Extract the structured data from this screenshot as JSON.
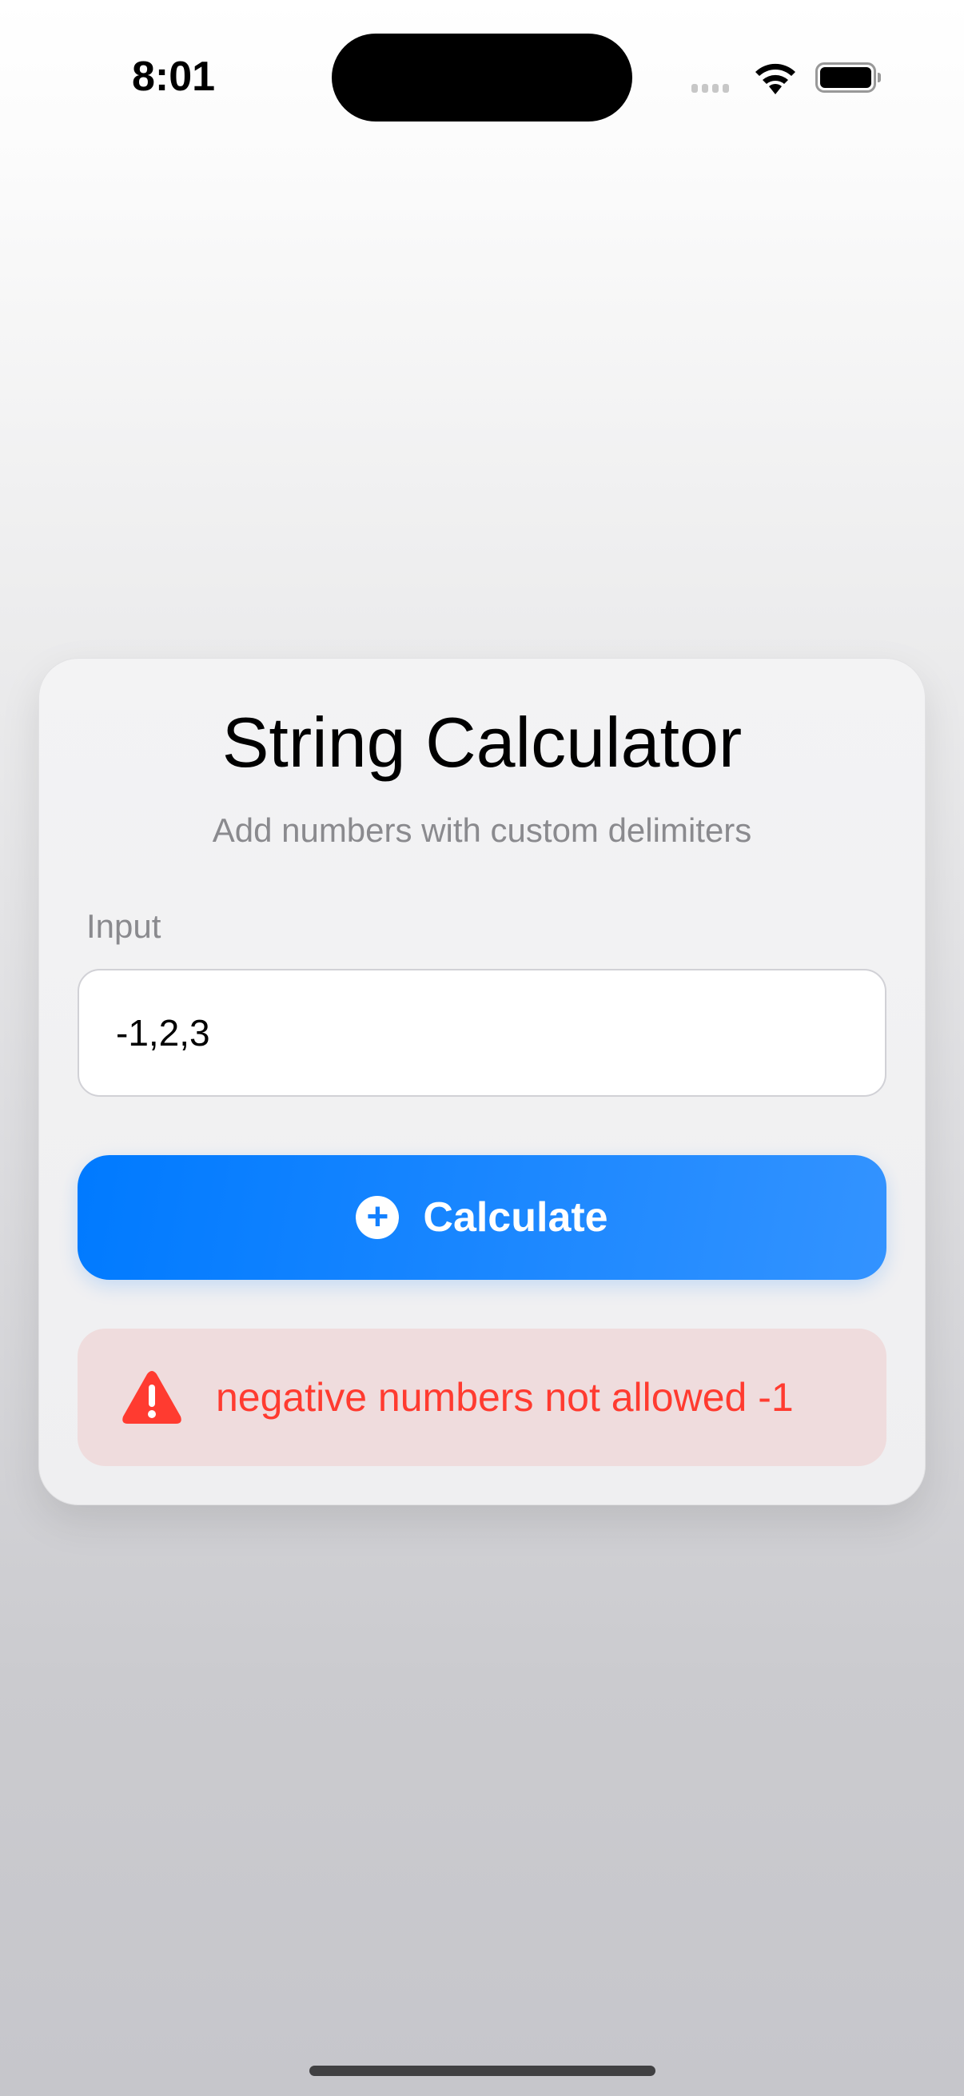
{
  "status_bar": {
    "time": "8:01",
    "icons": [
      "cellular-signal-icon",
      "wifi-icon",
      "battery-icon"
    ]
  },
  "card": {
    "title": "String Calculator",
    "subtitle": "Add numbers with custom delimiters",
    "input_label": "Input",
    "input_value": "-1,2,3",
    "calculate_label": "Calculate",
    "calculate_icon": "plus-circle-icon",
    "error_icon": "warning-triangle-icon",
    "error_message": "negative numbers not allowed -1"
  },
  "colors": {
    "accent": "#007aff",
    "error": "#ff3b30",
    "error_bg": "#efdcdd"
  }
}
